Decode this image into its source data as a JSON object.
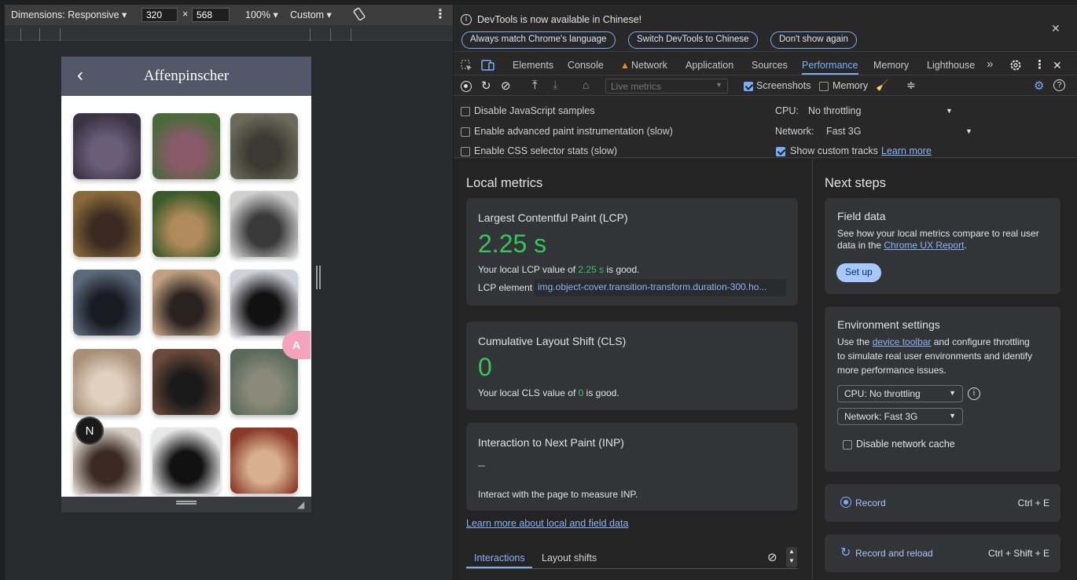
{
  "device_toolbar": {
    "dimensions_label": "Dimensions: Responsive ▾",
    "width": "320",
    "times": "×",
    "height": "568",
    "zoom": "100% ▾",
    "throttle": "Custom ▾"
  },
  "app": {
    "back": "‹",
    "title": "Affenpinscher",
    "translate_badge": "A",
    "avatar_letter": "N"
  },
  "infobar": {
    "message": "DevTools is now available in Chinese!",
    "btn_match": "Always match Chrome's language",
    "btn_switch": "Switch DevTools to Chinese",
    "btn_dont_show": "Don't show again",
    "close": "✕"
  },
  "tabs": {
    "items": [
      "Elements",
      "Console",
      "Network",
      "Application",
      "Sources",
      "Performance",
      "Memory",
      "Lighthouse"
    ],
    "active": "Performance",
    "more": "»"
  },
  "toolbar": {
    "live_metrics": "Live metrics",
    "screenshots": "Screenshots",
    "memory": "Memory"
  },
  "settings": {
    "disable_js": "Disable JavaScript samples",
    "adv_paint": "Enable advanced paint instrumentation (slow)",
    "css_stats": "Enable CSS selector stats (slow)",
    "cpu_label": "CPU:",
    "cpu_value": "No throttling",
    "network_label": "Network:",
    "network_value": "Fast 3G",
    "custom_tracks": "Show custom tracks",
    "learn_more": "Learn more"
  },
  "local_metrics": {
    "heading": "Local metrics",
    "lcp_title": "Largest Contentful Paint (LCP)",
    "lcp_value": "2.25 s",
    "lcp_desc_pre": "Your local LCP value of ",
    "lcp_desc_val": "2.25 s",
    "lcp_desc_post": " is good.",
    "lcp_element_label": "LCP element",
    "lcp_element_value": "img.object-cover.transition-transform.duration-300.ho...",
    "cls_title": "Cumulative Layout Shift (CLS)",
    "cls_value": "0",
    "cls_desc_pre": "Your local CLS value of ",
    "cls_desc_val": "0",
    "cls_desc_post": " is good.",
    "inp_title": "Interaction to Next Paint (INP)",
    "inp_value": "–",
    "inp_desc": "Interact with the page to measure INP.",
    "learn_link": "Learn more about local and field data",
    "tab_interactions": "Interactions",
    "tab_layout_shifts": "Layout shifts"
  },
  "next_steps": {
    "heading": "Next steps",
    "field_title": "Field data",
    "field_desc_1": "See how your local metrics compare to real user",
    "field_desc_2_pre": "data in the ",
    "field_desc_2_link": "Chrome UX Report",
    "field_desc_2_post": ".",
    "setup": "Set up",
    "env_title": "Environment settings",
    "env_desc_1_pre": "Use the ",
    "env_desc_1_link": "device toolbar",
    "env_desc_1_post": " and configure throttling",
    "env_desc_2": "to simulate real user environments and identify",
    "env_desc_3": "more performance issues.",
    "cpu_select": "CPU: No throttling",
    "net_select": "Network: Fast 3G",
    "disable_cache": "Disable network cache",
    "record": "Record",
    "record_shortcut": "Ctrl + E",
    "reload": "Record and reload",
    "reload_shortcut": "Ctrl + Shift + E"
  },
  "colors": {
    "accent": "#7cacf8",
    "good": "#34c759",
    "app_header": "#525868"
  }
}
